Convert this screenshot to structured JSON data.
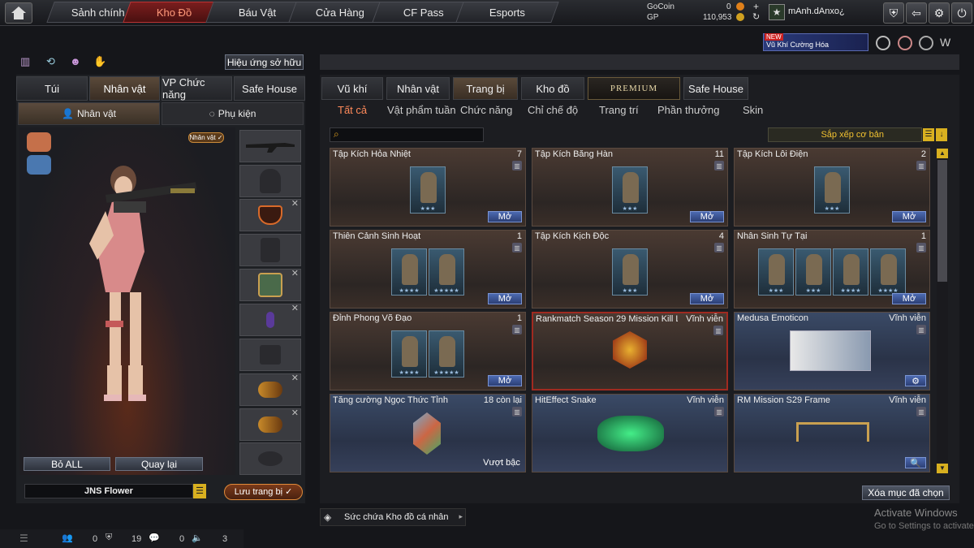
{
  "nav": {
    "tabs": [
      "Sảnh chính",
      "Kho Đồ",
      "Báu Vật",
      "Cửa Hàng",
      "CF Pass",
      "Esports"
    ],
    "active": "Kho Đồ"
  },
  "currency": {
    "gocoin_label": "GoCoin",
    "gocoin_value": "0",
    "gp_label": "GP",
    "gp_value": "110,953"
  },
  "user": {
    "name": "mAnh.dAnxo¿"
  },
  "promo": {
    "badge": "NEW",
    "text": "Vũ Khí Cường Hóa"
  },
  "left": {
    "effects_button": "Hiệu ứng sở hữu",
    "tabs": [
      "Túi",
      "Nhân vật",
      "VP Chức năng",
      "Safe House"
    ],
    "active_tab": "Nhân vật",
    "subtabs": [
      "Nhân vật",
      "Phụ kiện"
    ],
    "char_badge": "Nhân vật ✓",
    "remove_all": "Bỏ ALL",
    "back": "Quay lại",
    "character_name": "JNS Flower",
    "save_button": "Lưu trang bị ✓"
  },
  "right": {
    "tabs": [
      "Vũ khí",
      "Nhân vật",
      "Trang bị",
      "Kho đồ",
      "PREMIUM",
      "Safe House"
    ],
    "active_tab": "Trang bị",
    "categories": [
      "Tất cả",
      "Vật phẩm tuần",
      "Chức năng",
      "Chỉ chế độ",
      "Trang trí",
      "Phần thưởng",
      "Skin"
    ],
    "active_category": "Tất cả",
    "sort_label": "Sắp xếp cơ bản",
    "delete_selected": "Xóa mục đã chọn",
    "storage": "Sức chứa Kho đồ cá nhân"
  },
  "items": [
    {
      "name": "Tập Kích Hỏa Nhiệt",
      "count": "7",
      "action": "Mở",
      "thumbs": [
        "★★★"
      ],
      "style": "brown"
    },
    {
      "name": "Tập Kích Băng Hàn",
      "count": "11",
      "action": "Mở",
      "thumbs": [
        "★★★"
      ],
      "style": "brown"
    },
    {
      "name": "Tập Kích Lôi Điện",
      "count": "2",
      "action": "Mở",
      "thumbs": [
        "★★★"
      ],
      "style": "brown"
    },
    {
      "name": "Thiên Cảnh Sinh Hoạt",
      "count": "1",
      "action": "Mở",
      "thumbs": [
        "★★★★",
        "★★★★★"
      ],
      "style": "brown"
    },
    {
      "name": "Tập Kích Kịch Độc",
      "count": "4",
      "action": "Mở",
      "thumbs": [
        "★★★"
      ],
      "style": "brown"
    },
    {
      "name": "Nhân Sinh Tự Tại",
      "count": "1",
      "action": "Mở",
      "thumbs": [
        "★★★",
        "★★★",
        "★★★★",
        "★★★★"
      ],
      "style": "brown"
    },
    {
      "name": "Đỉnh Phong Võ Đạo",
      "count": "1",
      "action": "Mở",
      "thumbs": [
        "★★★★",
        "★★★★★"
      ],
      "style": "brown"
    },
    {
      "name": "Rankmatch Season 29 Mission Kill L",
      "count": "Vĩnh viễn",
      "action": "",
      "thumbs": [],
      "style": "red"
    },
    {
      "name": "Medusa Emoticon",
      "count": "Vĩnh viễn",
      "action": "⚙",
      "thumbs": [],
      "style": "blue"
    },
    {
      "name": "Tăng cường Ngọc Thức Tỉnh",
      "count": "18 còn lại",
      "action": "Vượt bậc",
      "thumbs": [],
      "style": "blue"
    },
    {
      "name": "HitEffect Snake",
      "count": "Vĩnh viễn",
      "action": "",
      "thumbs": [],
      "style": "blue"
    },
    {
      "name": "RM Mission S29 Frame",
      "count": "Vĩnh viễn",
      "action": "🔍",
      "thumbs": [],
      "style": "blue"
    }
  ],
  "footer": {
    "v1": "0",
    "v2": "19",
    "v3": "0",
    "v4": "3"
  },
  "watermark": {
    "title": "Activate Windows",
    "sub": "Go to Settings to activate Windows."
  }
}
